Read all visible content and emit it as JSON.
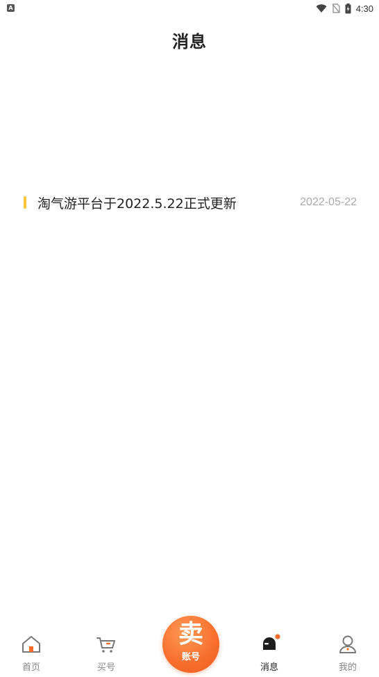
{
  "status_bar": {
    "app_indicator": "A",
    "time": "4:30",
    "icons": [
      "wifi-icon",
      "no-sim-icon",
      "battery-charging-icon"
    ]
  },
  "header": {
    "title": "消息"
  },
  "messages": [
    {
      "title": "淘气游平台于2022.5.22正式更新",
      "date": "2022-05-22",
      "accent_color": "#f8c43a"
    }
  ],
  "tab_bar": {
    "tabs": [
      {
        "label": "首页",
        "icon": "home-icon",
        "active": false
      },
      {
        "label": "买号",
        "icon": "cart-icon",
        "active": false
      },
      {
        "label": "消息",
        "icon": "message-bell-icon",
        "active": true,
        "has_badge": true
      },
      {
        "label": "我的",
        "icon": "user-icon",
        "active": false
      }
    ],
    "center_button": {
      "main_label": "卖",
      "sub_label": "账号",
      "color": "#f86d2c"
    }
  },
  "colors": {
    "accent_orange": "#f86d2c",
    "highlight_yellow": "#f8c43a",
    "muted_text": "#aaaaaa"
  }
}
